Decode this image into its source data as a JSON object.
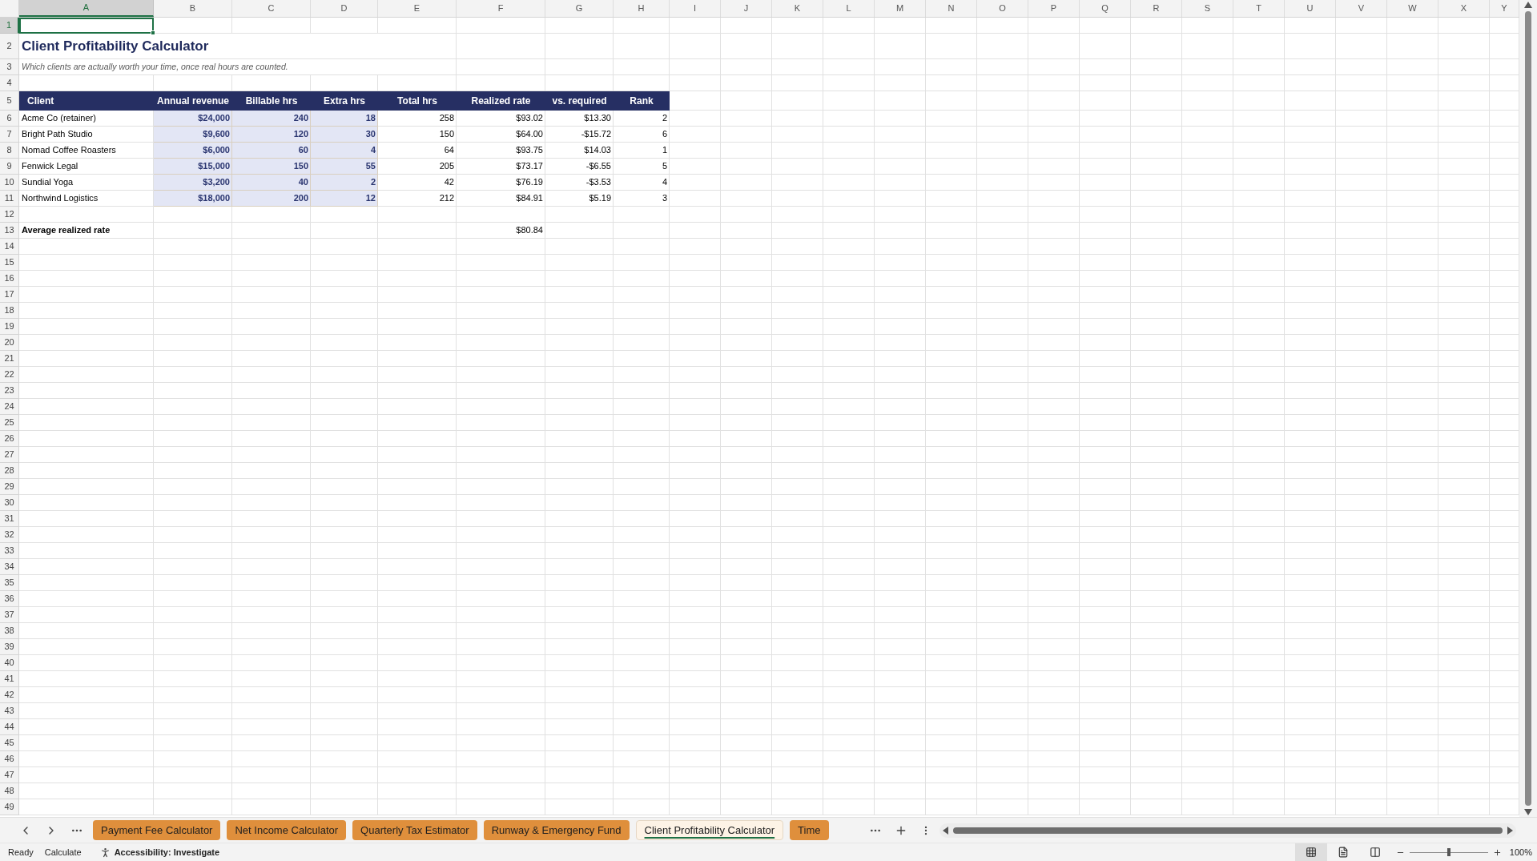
{
  "column_headers": [
    {
      "label": "A",
      "selected": true
    },
    {
      "label": "B",
      "selected": false
    },
    {
      "label": "C",
      "selected": false
    },
    {
      "label": "D",
      "selected": false
    },
    {
      "label": "E",
      "selected": false
    },
    {
      "label": "F",
      "selected": false
    },
    {
      "label": "G",
      "selected": false
    },
    {
      "label": "H",
      "selected": false
    },
    {
      "label": "I",
      "selected": false
    },
    {
      "label": "J",
      "selected": false
    },
    {
      "label": "K",
      "selected": false
    },
    {
      "label": "L",
      "selected": false
    },
    {
      "label": "M",
      "selected": false
    },
    {
      "label": "N",
      "selected": false
    },
    {
      "label": "O",
      "selected": false
    },
    {
      "label": "P",
      "selected": false
    },
    {
      "label": "Q",
      "selected": false
    },
    {
      "label": "R",
      "selected": false
    },
    {
      "label": "S",
      "selected": false
    },
    {
      "label": "T",
      "selected": false
    },
    {
      "label": "U",
      "selected": false
    },
    {
      "label": "V",
      "selected": false
    },
    {
      "label": "W",
      "selected": false
    },
    {
      "label": "X",
      "selected": false
    },
    {
      "label": "Y",
      "selected": false
    }
  ],
  "row_headers": [
    {
      "label": "1",
      "selected": true
    },
    {
      "label": "2",
      "selected": false
    },
    {
      "label": "3",
      "selected": false
    },
    {
      "label": "4",
      "selected": false
    },
    {
      "label": "5",
      "selected": false
    },
    {
      "label": "6",
      "selected": false
    },
    {
      "label": "7",
      "selected": false
    },
    {
      "label": "8",
      "selected": false
    },
    {
      "label": "9",
      "selected": false
    },
    {
      "label": "10",
      "selected": false
    },
    {
      "label": "11",
      "selected": false
    },
    {
      "label": "12",
      "selected": false
    },
    {
      "label": "13",
      "selected": false
    },
    {
      "label": "14",
      "selected": false
    },
    {
      "label": "15",
      "selected": false
    },
    {
      "label": "16",
      "selected": false
    },
    {
      "label": "17",
      "selected": false
    },
    {
      "label": "18",
      "selected": false
    },
    {
      "label": "19",
      "selected": false
    },
    {
      "label": "20",
      "selected": false
    },
    {
      "label": "21",
      "selected": false
    },
    {
      "label": "22",
      "selected": false
    },
    {
      "label": "23",
      "selected": false
    },
    {
      "label": "24",
      "selected": false
    },
    {
      "label": "25",
      "selected": false
    },
    {
      "label": "26",
      "selected": false
    },
    {
      "label": "27",
      "selected": false
    },
    {
      "label": "28",
      "selected": false
    },
    {
      "label": "29",
      "selected": false
    },
    {
      "label": "30",
      "selected": false
    },
    {
      "label": "31",
      "selected": false
    },
    {
      "label": "32",
      "selected": false
    },
    {
      "label": "33",
      "selected": false
    },
    {
      "label": "34",
      "selected": false
    },
    {
      "label": "35",
      "selected": false
    },
    {
      "label": "36",
      "selected": false
    },
    {
      "label": "37",
      "selected": false
    },
    {
      "label": "38",
      "selected": false
    },
    {
      "label": "39",
      "selected": false
    },
    {
      "label": "40",
      "selected": false
    },
    {
      "label": "41",
      "selected": false
    },
    {
      "label": "42",
      "selected": false
    },
    {
      "label": "43",
      "selected": false
    },
    {
      "label": "44",
      "selected": false
    },
    {
      "label": "45",
      "selected": false
    },
    {
      "label": "46",
      "selected": false
    },
    {
      "label": "47",
      "selected": false
    },
    {
      "label": "48",
      "selected": false
    },
    {
      "label": "49",
      "selected": false
    }
  ],
  "sheet": {
    "title": "Client Profitability Calculator",
    "subtitle": "Which clients are actually worth your time, once real hours are counted.",
    "columns": [
      {
        "label": "Client",
        "kind": "text"
      },
      {
        "label": "Annual revenue",
        "kind": "input"
      },
      {
        "label": "Billable hrs",
        "kind": "input"
      },
      {
        "label": "Extra hrs",
        "kind": "input"
      },
      {
        "label": "Total hrs",
        "kind": "output"
      },
      {
        "label": "Realized rate",
        "kind": "output"
      },
      {
        "label": "vs. required",
        "kind": "output"
      },
      {
        "label": "Rank",
        "kind": "output"
      }
    ],
    "rows": [
      {
        "cells": [
          "Acme Co (retainer)",
          "$24,000",
          "240",
          "18",
          "258",
          "$93.02",
          "$13.30",
          "2"
        ]
      },
      {
        "cells": [
          "Bright Path Studio",
          "$9,600",
          "120",
          "30",
          "150",
          "$64.00",
          "-$15.72",
          "6"
        ]
      },
      {
        "cells": [
          "Nomad Coffee Roasters",
          "$6,000",
          "60",
          "4",
          "64",
          "$93.75",
          "$14.03",
          "1"
        ]
      },
      {
        "cells": [
          "Fenwick Legal",
          "$15,000",
          "150",
          "55",
          "205",
          "$73.17",
          "-$6.55",
          "5"
        ]
      },
      {
        "cells": [
          "Sundial Yoga",
          "$3,200",
          "40",
          "2",
          "42",
          "$76.19",
          "-$3.53",
          "4"
        ]
      },
      {
        "cells": [
          "Northwind Logistics",
          "$18,000",
          "200",
          "12",
          "212",
          "$84.91",
          "$5.19",
          "3"
        ]
      }
    ],
    "summary": {
      "label": "Average realized rate",
      "value": "$80.84"
    }
  },
  "sheet_tabs": [
    {
      "label": "Payment Fee Calculator",
      "selected": false
    },
    {
      "label": "Net Income Calculator",
      "selected": false
    },
    {
      "label": "Quarterly Tax Estimator",
      "selected": false
    },
    {
      "label": "Runway & Emergency Fund",
      "selected": false
    },
    {
      "label": "Client Profitability Calculator",
      "selected": true
    },
    {
      "label": "Time",
      "selected": false
    }
  ],
  "status_bar": {
    "items": [
      "Ready",
      "Calculate"
    ],
    "accessibility": "Accessibility: Investigate",
    "views": [
      {
        "kind": "normal",
        "selected": true
      },
      {
        "kind": "page_layout",
        "selected": false
      },
      {
        "kind": "page_break",
        "selected": false
      }
    ],
    "zoom": {
      "level": 0.5,
      "reading": "100%"
    }
  }
}
